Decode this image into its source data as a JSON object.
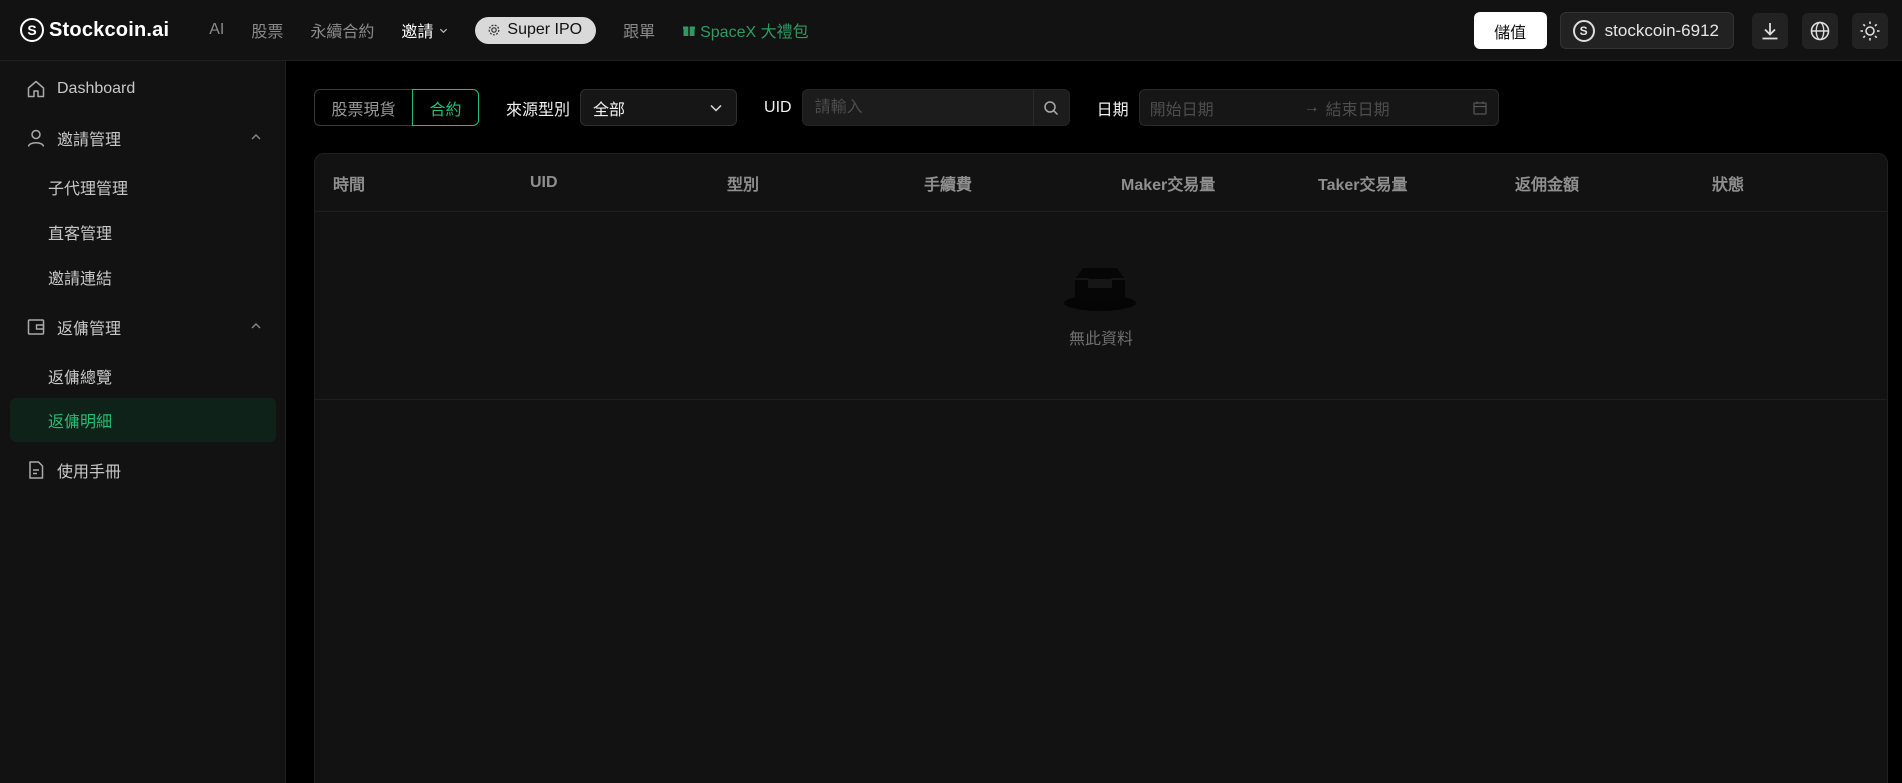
{
  "header": {
    "logo_text": "Stockcoin.ai",
    "logo_mark": "S",
    "nav": {
      "ai": "AI",
      "stocks": "股票",
      "perpetual": "永續合約",
      "invite": "邀請",
      "ipo": "Super IPO",
      "copy": "跟單",
      "gift": "SpaceX 大禮包"
    },
    "deposit_label": "儲值",
    "account_label": "stockcoin-6912",
    "icons": [
      "download-icon",
      "globe-icon",
      "sun-icon"
    ]
  },
  "sidebar": {
    "dashboard": "Dashboard",
    "invite_mgmt": "邀請管理",
    "invite_children": [
      "子代理管理",
      "直客管理",
      "邀請連結"
    ],
    "rebate_mgmt": "返傭管理",
    "rebate_children": [
      "返傭總覽",
      "返傭明細"
    ],
    "manual": "使用手冊"
  },
  "filters": {
    "segments": [
      "股票現貨",
      "合約"
    ],
    "source_label": "來源型別",
    "source_value": "全部",
    "uid_label": "UID",
    "uid_placeholder": "請輸入",
    "date_label": "日期",
    "start_placeholder": "開始日期",
    "end_placeholder": "結束日期",
    "arrow": "→"
  },
  "table": {
    "columns": [
      "時間",
      "UID",
      "型別",
      "手續費",
      "Maker交易量",
      "Taker交易量",
      "返佣金額",
      "狀態"
    ],
    "rows": [],
    "empty_text": "無此資料"
  },
  "colors": {
    "accent": "#1fbf74",
    "gift": "#2e9a62",
    "bg": "#000000",
    "panel": "#121212"
  }
}
